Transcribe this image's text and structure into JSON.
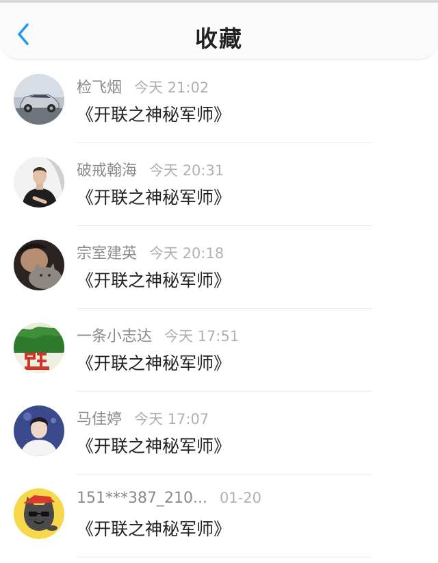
{
  "header": {
    "back_icon": "chevron-left-icon",
    "title": "收藏",
    "accent": "#2196f3"
  },
  "items": [
    {
      "name": "检飞烟",
      "time": "今天 21:02",
      "content": "《开联之神秘军师》",
      "avatar": "car-photo"
    },
    {
      "name": "破戒翰海",
      "time": "今天 20:31",
      "content": "《开联之神秘军师》",
      "avatar": "man-portrait"
    },
    {
      "name": "宗室建英",
      "time": "今天 20:18",
      "content": "《开联之神秘军师》",
      "avatar": "person-with-cat"
    },
    {
      "name": "一条小志达",
      "time": "今天 17:51",
      "content": "《开联之神秘军师》",
      "avatar": "green-poster"
    },
    {
      "name": "马佳婷",
      "time": "今天 17:07",
      "content": "《开联之神秘军师》",
      "avatar": "young-man-portrait"
    },
    {
      "name": "151***387_210...",
      "time": "01-20",
      "content": "《开联之神秘军师》",
      "avatar": "cartoon-cat"
    }
  ]
}
